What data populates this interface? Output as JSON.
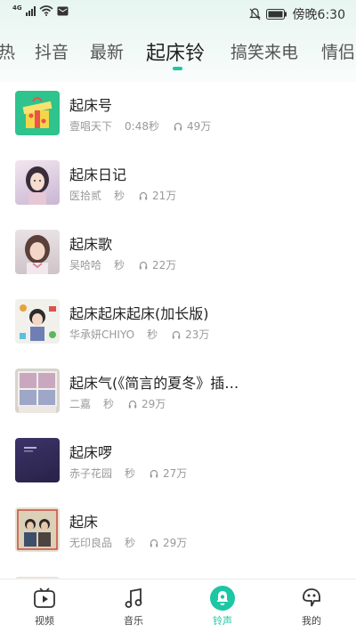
{
  "status_bar": {
    "network": "4G",
    "time": "傍晚6:30"
  },
  "tabs": [
    {
      "label": "热"
    },
    {
      "label": "抖音"
    },
    {
      "label": "最新"
    },
    {
      "label": "起床铃",
      "active": true
    },
    {
      "label": "搞笑来电"
    },
    {
      "label": "情侣"
    }
  ],
  "songs": [
    {
      "title": "起床号",
      "artist": "壹唱天下",
      "duration": "0:48秒",
      "plays": "49万",
      "cover": "gift-box-cover"
    },
    {
      "title": "起床日记",
      "artist": "医拾贰",
      "duration": "秒",
      "plays": "21万",
      "cover": "anime-girl-cover"
    },
    {
      "title": "起床歌",
      "artist": "吴哈哈",
      "duration": "秒",
      "plays": "22万",
      "cover": "girl-portrait-cover"
    },
    {
      "title": "起床起床起床(加长版)",
      "artist": "华承妍CHIYO",
      "duration": "秒",
      "plays": "23万",
      "cover": "cartoon-collage-cover"
    },
    {
      "title": "起床气(《简言的夏冬》插…",
      "artist": "二嘉",
      "duration": "秒",
      "plays": "29万",
      "cover": "window-sky-cover"
    },
    {
      "title": "起床啰",
      "artist": "赤子花园",
      "duration": "秒",
      "plays": "27万",
      "cover": "purple-album-cover"
    },
    {
      "title": "起床",
      "artist": "无印良品",
      "duration": "秒",
      "plays": "29万",
      "cover": "duo-photo-cover"
    }
  ],
  "bottom_nav": [
    {
      "label": "视频",
      "icon": "video-icon"
    },
    {
      "label": "音乐",
      "icon": "music-note-icon"
    },
    {
      "label": "铃声",
      "icon": "ringtone-bell-icon",
      "active": true
    },
    {
      "label": "我的",
      "icon": "profile-face-icon"
    }
  ],
  "colors": {
    "accent": "#1ec6a3",
    "text_primary": "#222222",
    "text_secondary": "#999999"
  }
}
